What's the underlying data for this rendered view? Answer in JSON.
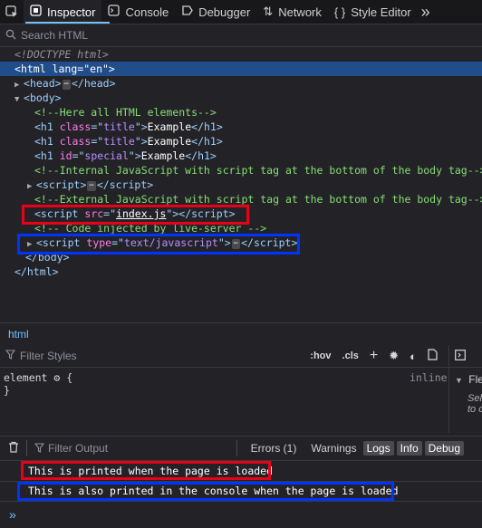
{
  "toolbar": {
    "tabs": [
      {
        "label": "Inspector",
        "icon": "inspector-icon"
      },
      {
        "label": "Console",
        "icon": "console-icon"
      },
      {
        "label": "Debugger",
        "icon": "debugger-icon"
      },
      {
        "label": "Network",
        "icon": "network-icon"
      },
      {
        "label": "Style Editor",
        "icon": "style-editor-icon"
      }
    ],
    "selected_tab": "Inspector",
    "overflow_glyph": "»"
  },
  "search": {
    "placeholder": "Search HTML"
  },
  "markup": {
    "doctype": "<!DOCTYPE html>",
    "html_open": {
      "tag": "html",
      "attr": "lang",
      "value": "en"
    },
    "head": "head",
    "body": "body",
    "comment1": "<!--Here all HTML elements-->",
    "h1_rows": [
      {
        "attr": "class",
        "value": "title",
        "text": "Example"
      },
      {
        "attr": "class",
        "value": "title",
        "text": "Example"
      },
      {
        "attr": "id",
        "value": "special",
        "text": "Example"
      }
    ],
    "comment2": "<!--Internal JavaScript with script tag at the bottom of the body tag-->",
    "script_inline": "script",
    "comment3": "<!--External JavaScript with script tag at the bottom of the body tag-->",
    "script_src": {
      "attr": "src",
      "value": "index.js"
    },
    "comment4": "<!-- Code injected by live-server -->",
    "script_type": {
      "attr": "type",
      "value": "text/javascript"
    },
    "body_close": "body",
    "html_close": "html"
  },
  "breadcrumb": "html",
  "rules": {
    "filter_placeholder": "Filter Styles",
    "hov": ":hov",
    "cls": ".cls",
    "element_label": "element",
    "inline_label": "inline",
    "side_panel_text_1": "Fle",
    "side_panel_text_2": "Sel",
    "side_panel_text_3": "to c"
  },
  "console": {
    "filter_placeholder": "Filter Output",
    "errors": "Errors (1)",
    "warnings": "Warnings",
    "logs": "Logs",
    "info": "Info",
    "debug": "Debug",
    "messages": [
      "This is printed when the page is loaded",
      "This is also printed in the console when the page is loaded"
    ],
    "prompt_glyph": "»"
  },
  "colors": {
    "highlight_red": "#e8001b",
    "highlight_blue": "#0033ff",
    "selection": "#204e8a"
  }
}
